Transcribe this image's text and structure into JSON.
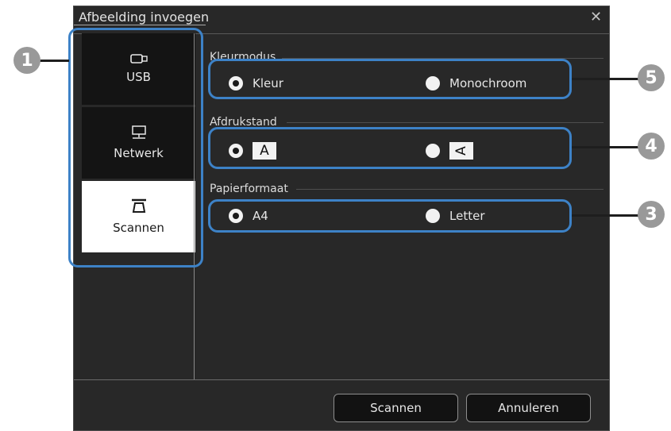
{
  "dialog": {
    "title": "Afbeelding invoegen",
    "close_icon": "close-icon"
  },
  "sidebar": {
    "items": [
      {
        "label": "USB",
        "icon": "usb-drive-icon",
        "selected": false
      },
      {
        "label": "Netwerk",
        "icon": "network-icon",
        "selected": false
      },
      {
        "label": "Scannen",
        "icon": "scanner-icon",
        "selected": true
      }
    ]
  },
  "sections": {
    "color_mode": {
      "label": "Kleurmodus",
      "options": [
        "Kleur",
        "Monochroom"
      ],
      "selected": "Kleur"
    },
    "orientation": {
      "label": "Afdrukstand",
      "options": [
        "A",
        "A"
      ],
      "selected_index": 0
    },
    "paper_size": {
      "label": "Papierformaat",
      "options": [
        "A4",
        "Letter"
      ],
      "selected": "A4"
    }
  },
  "buttons": {
    "scan": "Scannen",
    "cancel": "Annuleren"
  },
  "callouts": [
    "1",
    "5",
    "4",
    "3"
  ],
  "colors": {
    "callout_border": "#3d82c7",
    "callout_badge": "#999999",
    "dialog_bg": "#282828"
  }
}
